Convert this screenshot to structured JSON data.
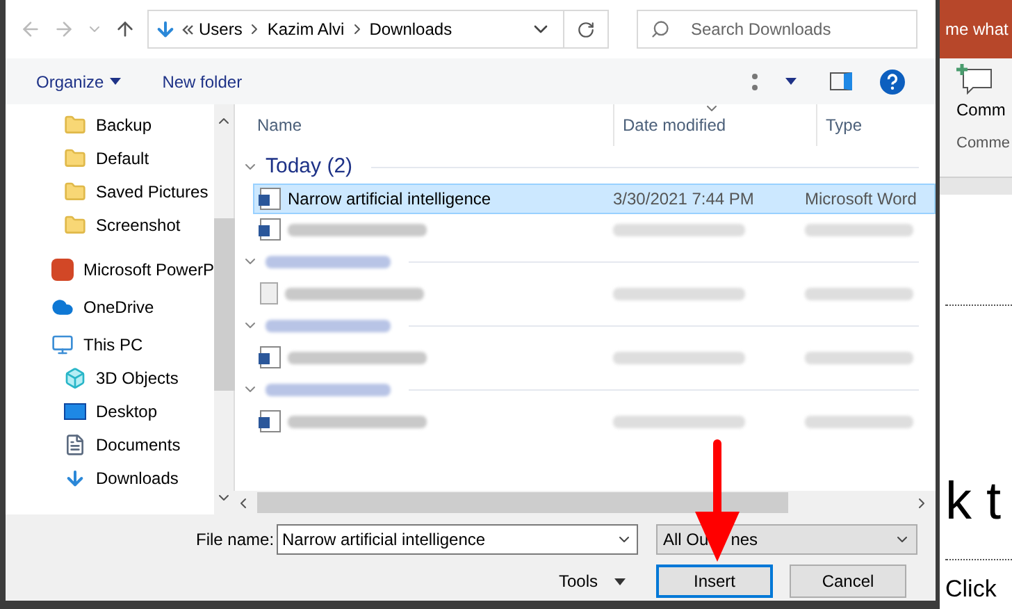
{
  "address": {
    "path": [
      "Users",
      "Kazim Alvi",
      "Downloads"
    ]
  },
  "search": {
    "placeholder": "Search Downloads"
  },
  "toolbar": {
    "organize": "Organize",
    "new_folder": "New folder"
  },
  "sidebar": {
    "items": [
      {
        "label": "Backup",
        "kind": "folder"
      },
      {
        "label": "Default",
        "kind": "folder"
      },
      {
        "label": "Saved Pictures",
        "kind": "folder"
      },
      {
        "label": "Screenshot",
        "kind": "folder"
      },
      {
        "label": "Microsoft PowerP",
        "kind": "powerpoint"
      },
      {
        "label": "OneDrive",
        "kind": "cloud"
      },
      {
        "label": "This PC",
        "kind": "pc",
        "children": [
          {
            "label": "3D Objects",
            "kind": "cube"
          },
          {
            "label": "Desktop",
            "kind": "desktop"
          },
          {
            "label": "Documents",
            "kind": "document"
          },
          {
            "label": "Downloads",
            "kind": "download"
          }
        ]
      }
    ]
  },
  "table": {
    "columns": [
      {
        "label": "Name",
        "sorted": false
      },
      {
        "label": "Date modified",
        "sorted": true
      },
      {
        "label": "Type",
        "sorted": false
      }
    ],
    "groups": [
      {
        "label": "Today (2)",
        "redacted": false,
        "rows": [
          {
            "name": "Narrow artificial intelligence",
            "date": "3/30/2021 7:44 PM",
            "type": "Microsoft Word",
            "kind": "word",
            "selected": true,
            "redacted": false
          },
          {
            "kind": "word",
            "selected": false,
            "redacted": true
          }
        ]
      },
      {
        "redacted": true,
        "rows": [
          {
            "kind": "text",
            "selected": false,
            "redacted": true
          }
        ]
      },
      {
        "redacted": true,
        "rows": [
          {
            "kind": "word",
            "selected": false,
            "redacted": true
          }
        ]
      },
      {
        "redacted": true,
        "rows": [
          {
            "kind": "word",
            "selected": false,
            "redacted": true
          }
        ]
      }
    ]
  },
  "footer": {
    "file_name_label": "File name:",
    "file_name": "Narrow artificial intelligence",
    "filter_parts": [
      "All Ou",
      "nes"
    ],
    "buttons": [
      {
        "label": "Tools",
        "kind": "menu"
      },
      {
        "label": "Insert",
        "kind": "default"
      },
      {
        "label": "Cancel",
        "kind": "plain"
      }
    ]
  },
  "background_app": {
    "tell_me": "me what",
    "comment_button": "Comm",
    "group_label": "Comme",
    "slide_title": "k t",
    "slide_placeholder": "Click"
  }
}
